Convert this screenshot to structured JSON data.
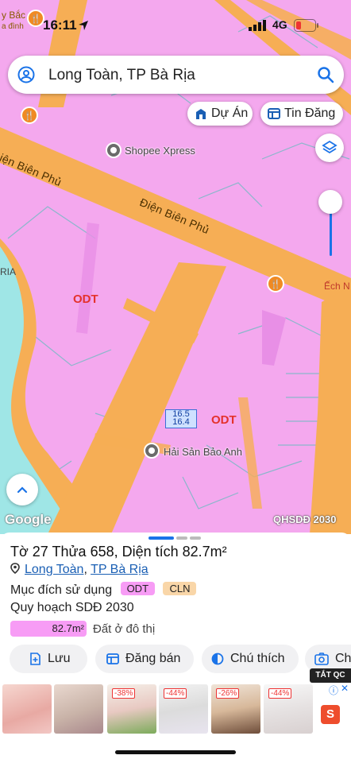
{
  "status_bar": {
    "time": "16:11",
    "network": "4G"
  },
  "map": {
    "corner_labels": [
      "y Bắc",
      "a đình",
      "RIA",
      "Ếch N"
    ],
    "search": {
      "value": "Long Toàn, TP Bà Rịa"
    },
    "chips": {
      "du_an": "Dự Án",
      "tin_dang": "Tin Đăng"
    },
    "roads": [
      "Điện Biên Phủ",
      "Điện Biên Phủ"
    ],
    "pois": [
      "Shopee Xpress",
      "Hải Sản Bảo Anh"
    ],
    "zones": [
      "ODT",
      "ODT"
    ],
    "parcel_label": {
      "top": "16.5",
      "bottom": "16.4"
    },
    "google": "Google",
    "overlay_name": "QHSDĐ 2030",
    "colors": {
      "residential_land": "#f4a8ee",
      "roads": "#f6ae55",
      "water": "#9fe6e6",
      "parcel_lines": "#7fb8c8"
    }
  },
  "sheet": {
    "title": "Tờ 27 Thửa 658, Diện tích 82.7m²",
    "location": {
      "ward": "Long Toàn",
      "separator": ", ",
      "city": "TP Bà Rịa"
    },
    "purpose_label": "Mục đích sử dụng",
    "tags": [
      {
        "text": "ODT",
        "color": "#f79cf5"
      },
      {
        "text": "CLN",
        "color": "#f9d6a8"
      }
    ],
    "plan_label": "Quy hoạch SDĐ 2030",
    "area_value": "82.7m²",
    "area_desc": "Đất ở đô thị",
    "actions": {
      "save": "Lưu",
      "post": "Đăng bán",
      "legend": "Chú thích",
      "capture": "Ch"
    }
  },
  "ads": {
    "close_label": "TẮT QC",
    "discounts": [
      "-38%",
      "-44%",
      "-26%",
      "-44%"
    ],
    "shopee_logo": "S"
  }
}
